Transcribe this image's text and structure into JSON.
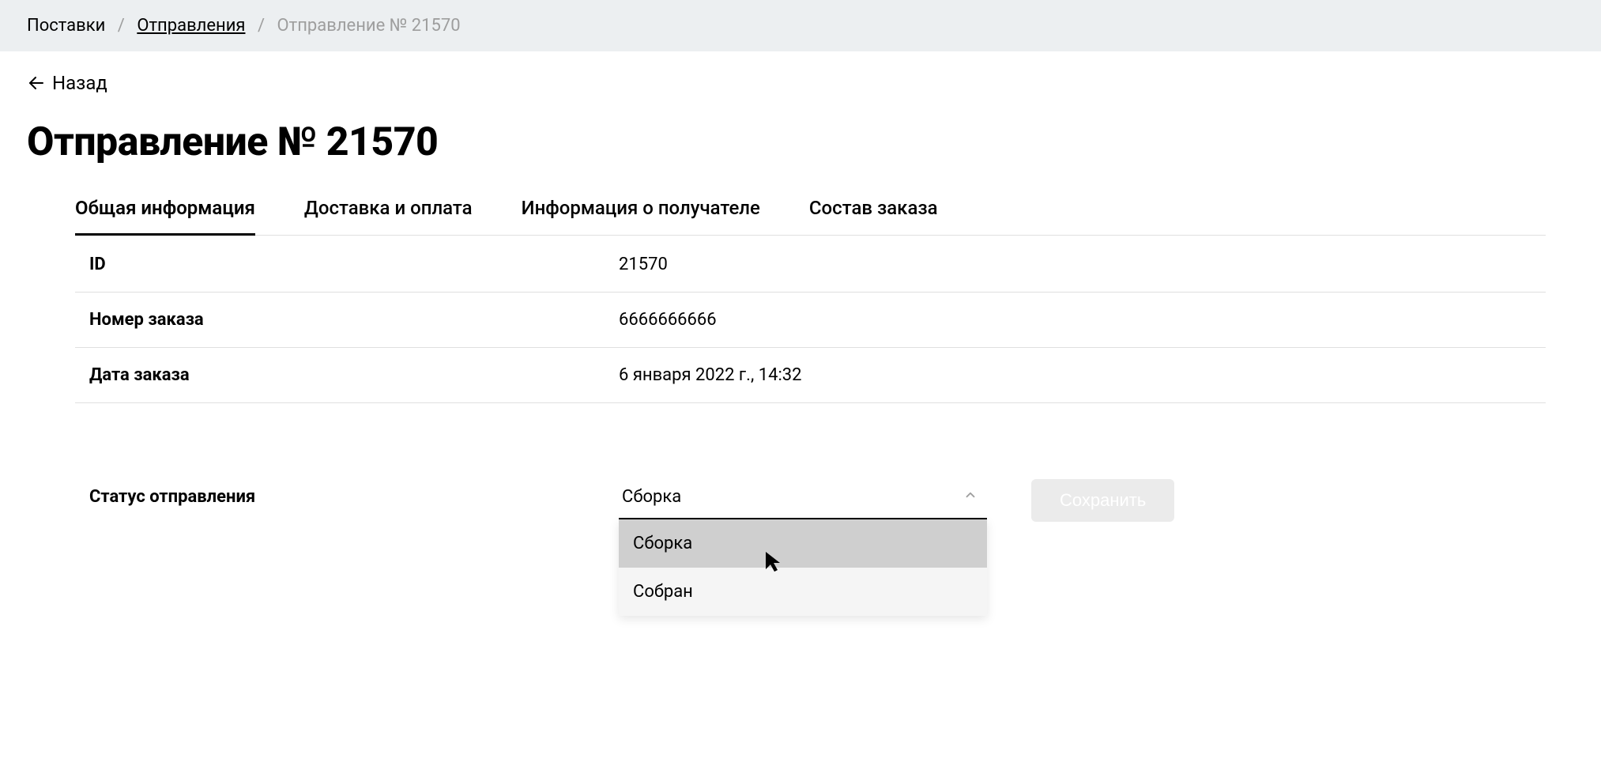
{
  "breadcrumbs": {
    "item0": "Поставки",
    "item1": "Отправления",
    "current": "Отправление № 21570"
  },
  "back_label": "Назад",
  "page_title": "Отправление № 21570",
  "tabs": {
    "general": "Общая информация",
    "delivery": "Доставка и оплата",
    "recipient": "Информация о получателе",
    "composition": "Состав заказа"
  },
  "fields": {
    "id": {
      "label": "ID",
      "value": "21570"
    },
    "order_number": {
      "label": "Номер заказа",
      "value": "6666666666"
    },
    "order_date": {
      "label": "Дата заказа",
      "value": "6 января 2022 г., 14:32"
    }
  },
  "status": {
    "label": "Статус отправления",
    "selected": "Сборка",
    "options": {
      "assembly": "Сборка",
      "assembled": "Собран"
    }
  },
  "save_button": "Сохранить"
}
